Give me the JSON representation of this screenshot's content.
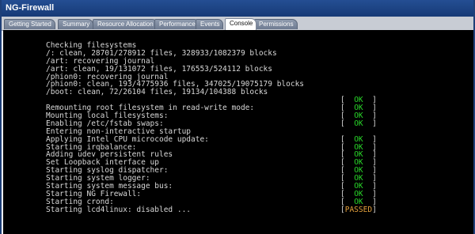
{
  "window": {
    "title": "NG-Firewall"
  },
  "tabs": [
    {
      "label": "Getting Started",
      "active": false
    },
    {
      "label": "Summary",
      "active": false
    },
    {
      "label": "Resource Allocation",
      "active": false
    },
    {
      "label": "Performance",
      "active": false
    },
    {
      "label": "Events",
      "active": false
    },
    {
      "label": "Console",
      "active": true
    },
    {
      "label": "Permissions",
      "active": false
    }
  ],
  "console": {
    "lines": [
      {
        "text": "Checking filesystems",
        "status": ""
      },
      {
        "text": "/: clean, 28701/278912 files, 328933/1082379 blocks",
        "status": ""
      },
      {
        "text": "/art: recovering journal",
        "status": ""
      },
      {
        "text": "/art: clean, 19/131072 files, 176553/524112 blocks",
        "status": ""
      },
      {
        "text": "/phion0: recovering journal",
        "status": ""
      },
      {
        "text": "/phion0: clean, 193/4775936 files, 347025/19075179 blocks",
        "status": ""
      },
      {
        "text": "/boot: clean, 72/26104 files, 19134/104388 blocks",
        "status": ""
      },
      {
        "text": "",
        "status": "OK"
      },
      {
        "text": "Remounting root filesystem in read-write mode:",
        "status": "OK"
      },
      {
        "text": "Mounting local filesystems:",
        "status": "OK"
      },
      {
        "text": "Enabling /etc/fstab swaps:",
        "status": "OK"
      },
      {
        "text": "Entering non-interactive startup",
        "status": ""
      },
      {
        "text": "Applying Intel CPU microcode update:",
        "status": "OK"
      },
      {
        "text": "Starting irqbalance:",
        "status": "OK"
      },
      {
        "text": "Adding udev persistent rules",
        "status": "OK"
      },
      {
        "text": "Set Loopback interface up",
        "status": "OK"
      },
      {
        "text": "Starting syslog dispatcher:",
        "status": "OK"
      },
      {
        "text": "Starting system logger:",
        "status": "OK"
      },
      {
        "text": "Starting system message bus:",
        "status": "OK"
      },
      {
        "text": "Starting NG Firewall:",
        "status": "OK"
      },
      {
        "text": "Starting crond:",
        "status": "OK"
      },
      {
        "text": "Starting lcd4linux: disabled ...",
        "status": "PASSED"
      }
    ]
  },
  "colors": {
    "titlebar": "#1f4486",
    "console_background": "#000000",
    "console_text": "#d8d8d8",
    "status_ok": "#29d829",
    "status_passed": "#e6a23c"
  }
}
